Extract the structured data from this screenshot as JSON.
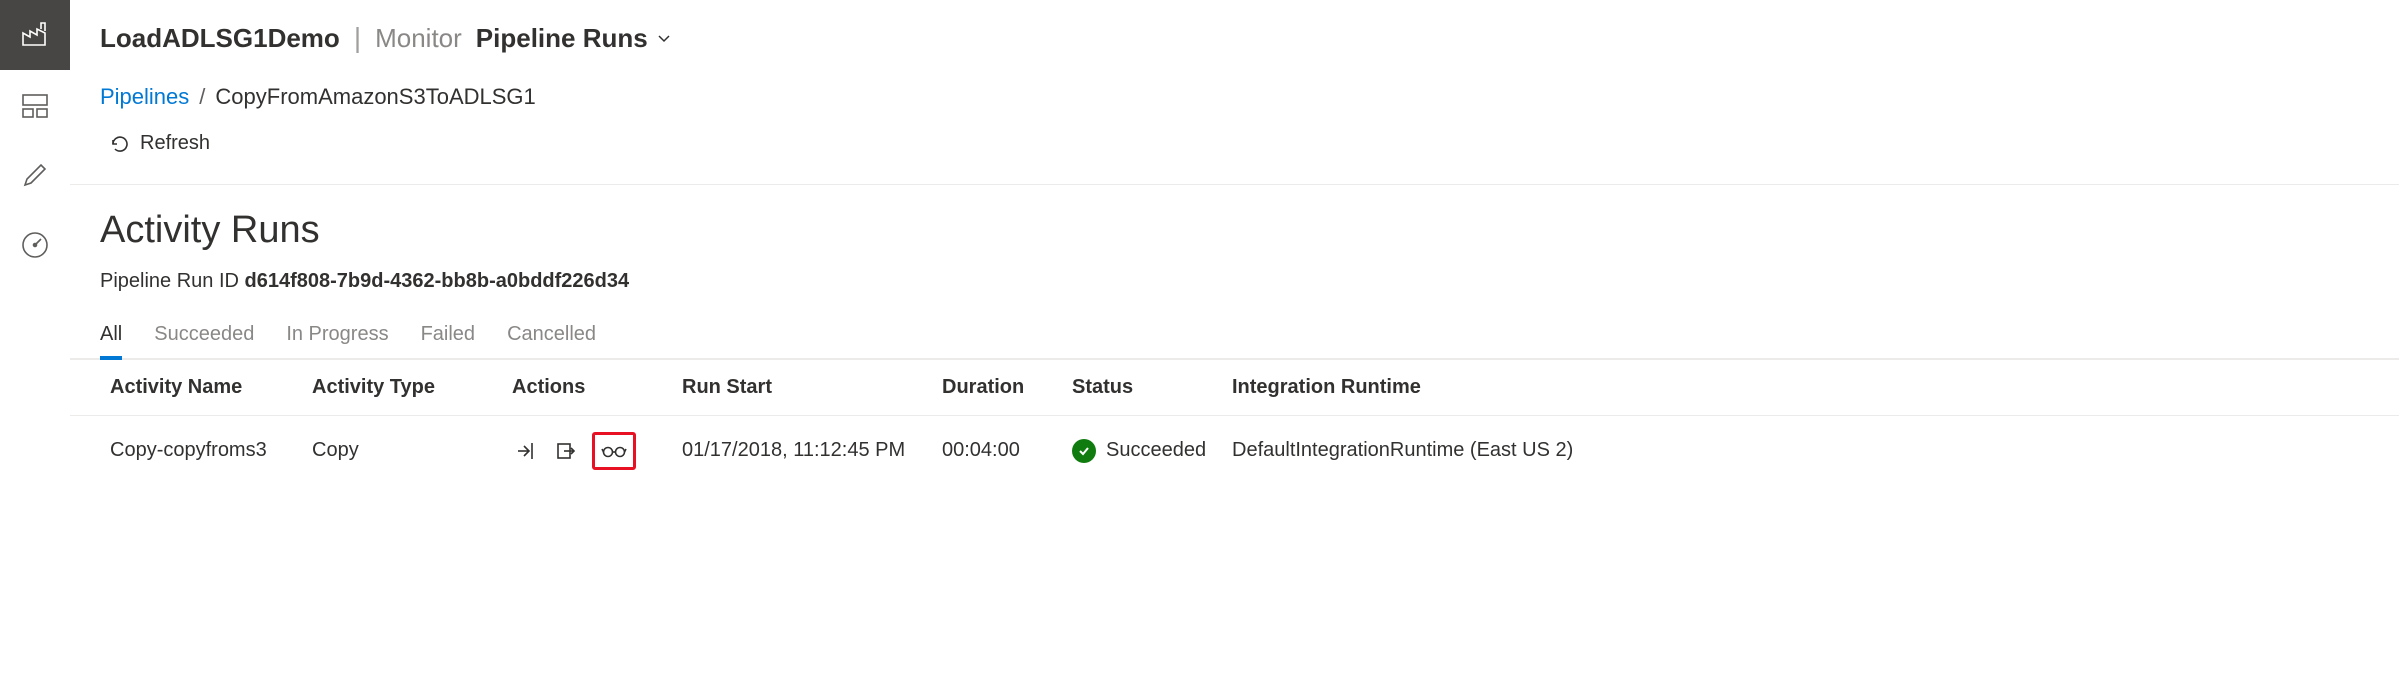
{
  "header": {
    "title": "LoadADLSG1Demo",
    "subtitle": "Monitor",
    "dropdown": "Pipeline Runs"
  },
  "breadcrumb": {
    "link": "Pipelines",
    "sep": "/",
    "current": "CopyFromAmazonS3ToADLSG1"
  },
  "refresh": {
    "label": "Refresh"
  },
  "section": {
    "title": "Activity Runs",
    "run_id_label": "Pipeline Run ID ",
    "run_id_value": "d614f808-7b9d-4362-bb8b-a0bddf226d34"
  },
  "tabs": [
    {
      "label": "All",
      "active": true
    },
    {
      "label": "Succeeded",
      "active": false
    },
    {
      "label": "In Progress",
      "active": false
    },
    {
      "label": "Failed",
      "active": false
    },
    {
      "label": "Cancelled",
      "active": false
    }
  ],
  "table": {
    "headers": {
      "activity_name": "Activity Name",
      "activity_type": "Activity Type",
      "actions": "Actions",
      "run_start": "Run Start",
      "duration": "Duration",
      "status": "Status",
      "integration_runtime": "Integration Runtime"
    },
    "rows": [
      {
        "activity_name": "Copy-copyfroms3",
        "activity_type": "Copy",
        "run_start": "01/17/2018, 11:12:45 PM",
        "duration": "00:04:00",
        "status": "Succeeded",
        "integration_runtime": "DefaultIntegrationRuntime (East US 2)"
      }
    ]
  }
}
